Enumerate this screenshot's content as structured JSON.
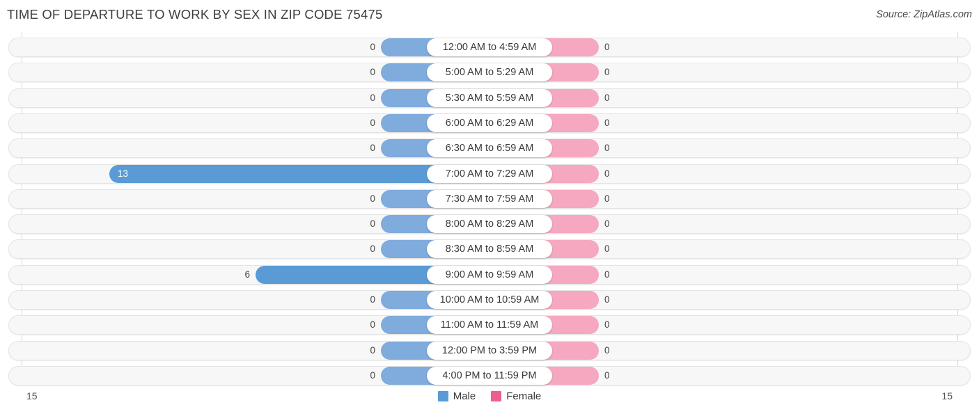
{
  "header": {
    "title": "TIME OF DEPARTURE TO WORK BY SEX IN ZIP CODE 75475",
    "source": "Source: ZipAtlas.com"
  },
  "legend": {
    "male_label": "Male",
    "male_color": "#5b9bd5",
    "female_label": "Female",
    "female_color": "#ee5f8f"
  },
  "axis": {
    "left_tick": "15",
    "right_tick": "15"
  },
  "chart_data": {
    "type": "bar",
    "title": "TIME OF DEPARTURE TO WORK BY SEX IN ZIP CODE 75475",
    "subtitle": "",
    "orientation": "horizontal-diverging",
    "xlabel": "",
    "ylabel": "",
    "xlim": [
      15,
      15
    ],
    "grid": true,
    "legend_position": "bottom-center",
    "categories": [
      "12:00 AM to 4:59 AM",
      "5:00 AM to 5:29 AM",
      "5:30 AM to 5:59 AM",
      "6:00 AM to 6:29 AM",
      "6:30 AM to 6:59 AM",
      "7:00 AM to 7:29 AM",
      "7:30 AM to 7:59 AM",
      "8:00 AM to 8:29 AM",
      "8:30 AM to 8:59 AM",
      "9:00 AM to 9:59 AM",
      "10:00 AM to 10:59 AM",
      "11:00 AM to 11:59 AM",
      "12:00 PM to 3:59 PM",
      "4:00 PM to 11:59 PM"
    ],
    "series": [
      {
        "name": "Male",
        "color": "#5b9bd5",
        "values": [
          0,
          0,
          0,
          0,
          0,
          13,
          0,
          0,
          0,
          6,
          0,
          0,
          0,
          0
        ]
      },
      {
        "name": "Female",
        "color": "#ee5f8f",
        "values": [
          0,
          0,
          0,
          0,
          0,
          0,
          0,
          0,
          0,
          0,
          0,
          0,
          0,
          0
        ]
      }
    ]
  },
  "rows": [
    {
      "label": "12:00 AM to 4:59 AM",
      "male": "0",
      "female": "0"
    },
    {
      "label": "5:00 AM to 5:29 AM",
      "male": "0",
      "female": "0"
    },
    {
      "label": "5:30 AM to 5:59 AM",
      "male": "0",
      "female": "0"
    },
    {
      "label": "6:00 AM to 6:29 AM",
      "male": "0",
      "female": "0"
    },
    {
      "label": "6:30 AM to 6:59 AM",
      "male": "0",
      "female": "0"
    },
    {
      "label": "7:00 AM to 7:29 AM",
      "male": "13",
      "female": "0"
    },
    {
      "label": "7:30 AM to 7:59 AM",
      "male": "0",
      "female": "0"
    },
    {
      "label": "8:00 AM to 8:29 AM",
      "male": "0",
      "female": "0"
    },
    {
      "label": "8:30 AM to 8:59 AM",
      "male": "0",
      "female": "0"
    },
    {
      "label": "9:00 AM to 9:59 AM",
      "male": "6",
      "female": "0"
    },
    {
      "label": "10:00 AM to 10:59 AM",
      "male": "0",
      "female": "0"
    },
    {
      "label": "11:00 AM to 11:59 AM",
      "male": "0",
      "female": "0"
    },
    {
      "label": "12:00 PM to 3:59 PM",
      "male": "0",
      "female": "0"
    },
    {
      "label": "4:00 PM to 11:59 PM",
      "male": "0",
      "female": "0"
    }
  ]
}
